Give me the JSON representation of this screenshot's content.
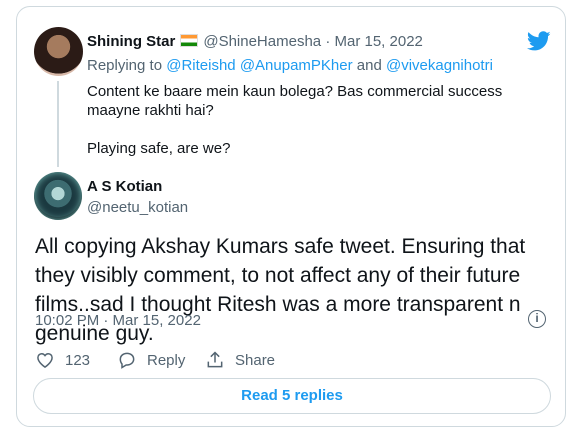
{
  "tweet1": {
    "name": "Shining Star",
    "handle": "@ShineHamesha",
    "dot": "·",
    "date": "Mar 15, 2022",
    "replying_prefix": "Replying to",
    "reply_to_1": "@Riteishd",
    "reply_to_2": "@AnupamPKher",
    "reply_and": "and",
    "reply_to_3": "@vivekagnihotri",
    "text_line1": "Content ke baare mein kaun bolega? Bas commercial success maayne rakhti hai?",
    "text_line2": "Playing safe, are we?"
  },
  "tweet2": {
    "name": "A S Kotian",
    "handle": "@neetu_kotian",
    "text": "All copying Akshay Kumars safe tweet. Ensuring that they visibly comment, to not affect any of their future films..sad I thought Ritesh was a more transparent n genuine guy.",
    "timestamp": "10:02 PM · Mar 15, 2022",
    "like_count": "123",
    "reply_label": "Reply",
    "share_label": "Share",
    "read_replies_label": "Read 5 replies"
  },
  "colors": {
    "accent": "#1d9bf0",
    "secondary_text": "#536471",
    "border": "#cfd9de"
  },
  "icons": [
    "twitter-bird-icon",
    "india-flag-icon",
    "info-icon",
    "heart-icon",
    "reply-bubble-icon",
    "share-icon"
  ]
}
